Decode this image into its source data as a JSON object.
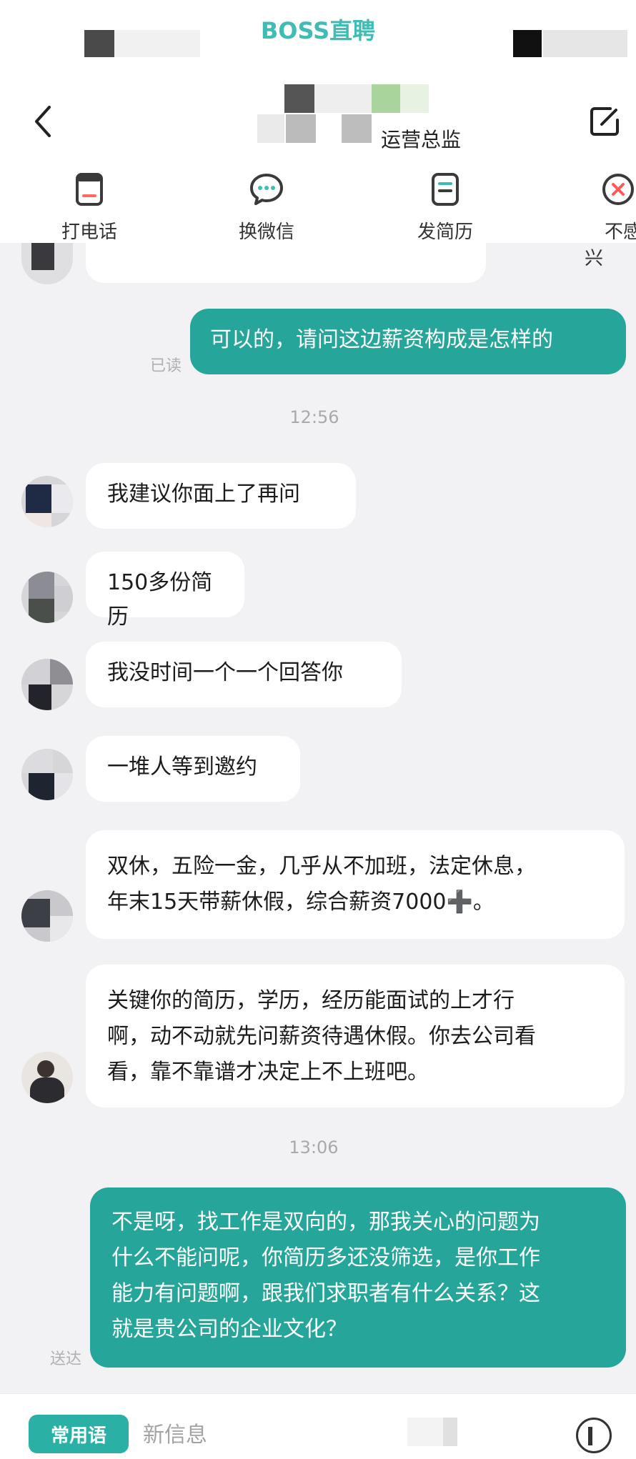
{
  "header": {
    "app_name": "BOSS直聘",
    "title": "运营总监",
    "accent_color": "#3fbcb4"
  },
  "actions": [
    {
      "label": "打电话",
      "icon": "phone-icon"
    },
    {
      "label": "换微信",
      "icon": "chat-bubble-icon"
    },
    {
      "label": "发简历",
      "icon": "resume-icon"
    },
    {
      "label": "不感兴",
      "icon": "close-circle-icon"
    }
  ],
  "messages": [
    {
      "side": "out",
      "lines": [
        "可以的，请问这边薪资构成是怎样的"
      ],
      "status": "已读"
    },
    {
      "type": "time",
      "text": "12:56"
    },
    {
      "side": "in",
      "lines": [
        "我建议你面上了再问"
      ]
    },
    {
      "side": "in",
      "lines": [
        "150多份简历"
      ]
    },
    {
      "side": "in",
      "lines": [
        "我没时间一个一个回答你"
      ]
    },
    {
      "side": "in",
      "lines": [
        "一堆人等到邀约"
      ]
    },
    {
      "side": "in",
      "lines": [
        "双休，五险一金，几乎从不加班，法定休息，",
        "年末15天带薪休假，综合薪资7000➕。"
      ]
    },
    {
      "side": "in",
      "lines": [
        "关键你的简历，学历，经历能面试的上才行",
        "啊，动不动就先问薪资待遇休假。你去公司看",
        "看，靠不靠谱才决定上不上班吧。"
      ]
    },
    {
      "type": "time",
      "text": "13:06"
    },
    {
      "side": "out",
      "lines": [
        "不是呀，找工作是双向的，那我关心的问题为",
        "什么不能问呢，你简历多还没筛选，是你工作",
        "能力有问题啊，跟我们求职者有什么关系？这",
        "就是贵公司的企业文化？"
      ],
      "status": "送达"
    }
  ],
  "composer": {
    "quick_phrase": "常用语",
    "placeholder": "新信息"
  },
  "colors": {
    "outgoing_bubble": "#26a69a",
    "incoming_bubble": "#ffffff",
    "background": "#f2f2f4"
  }
}
